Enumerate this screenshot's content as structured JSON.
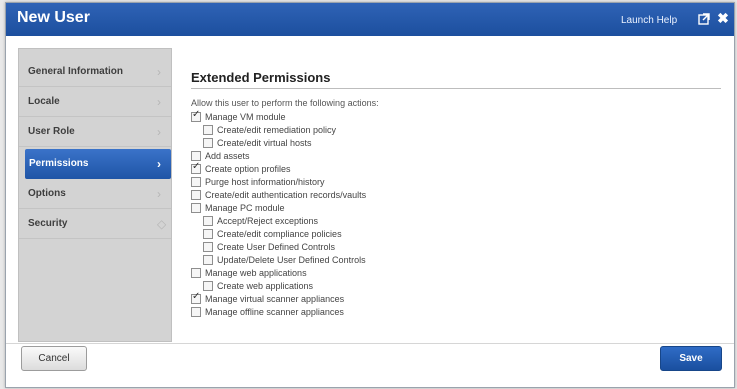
{
  "window": {
    "title": "New User",
    "launch_help": "Launch Help",
    "popout_icon": "popout-icon",
    "close_icon": "close-icon",
    "close_glyph": "✖",
    "accent_color": "#1f55a6"
  },
  "sidebar": {
    "items": [
      {
        "label": "General Information",
        "chevron": "›"
      },
      {
        "label": "Locale",
        "chevron": "›"
      },
      {
        "label": "User Role",
        "chevron": "›"
      },
      {
        "label": "Permissions",
        "chevron": "›",
        "active": true
      },
      {
        "label": "Options",
        "chevron": "›"
      },
      {
        "label": "Security",
        "chevron": "◇"
      }
    ]
  },
  "permissions": {
    "title": "Extended Permissions",
    "instruction": "Allow this user to perform the following actions:",
    "items": [
      {
        "label": "Manage VM module",
        "checked": true
      },
      {
        "label": "Create/edit remediation policy",
        "checked": false
      },
      {
        "label": "Create/edit virtual hosts",
        "checked": false
      },
      {
        "label": "Add assets",
        "checked": false
      },
      {
        "label": "Create option profiles",
        "checked": true
      },
      {
        "label": "Purge host information/history",
        "checked": false
      },
      {
        "label": "Create/edit authentication records/vaults",
        "checked": false
      },
      {
        "label": "Manage PC module",
        "checked": false
      },
      {
        "label": "Accept/Reject exceptions",
        "checked": false
      },
      {
        "label": "Create/edit compliance policies",
        "checked": false
      },
      {
        "label": "Create User Defined Controls",
        "checked": false
      },
      {
        "label": "Update/Delete User Defined Controls",
        "checked": false
      },
      {
        "label": "Manage web applications",
        "checked": false
      },
      {
        "label": "Create web applications",
        "checked": false
      },
      {
        "label": "Manage virtual scanner appliances",
        "checked": true
      },
      {
        "label": "Manage offline scanner appliances",
        "checked": false
      }
    ]
  },
  "footer": {
    "cancel_label": "Cancel",
    "save_label": "Save"
  }
}
